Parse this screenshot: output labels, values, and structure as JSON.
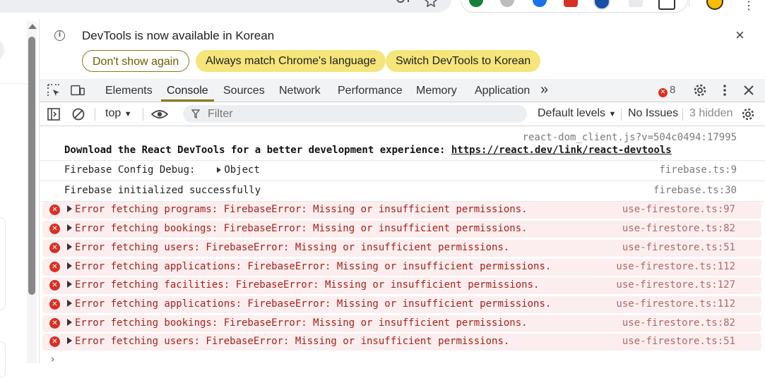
{
  "browser": {
    "extension_colors": [
      "#188038",
      "#9e9e9e",
      "#1a73e8",
      "#d93025",
      "#174ea6"
    ]
  },
  "infobar": {
    "message": "DevTools is now available in Korean",
    "dont_show_again": "Don't show again",
    "always_match": "Always match Chrome's language",
    "switch_korean": "Switch DevTools to Korean",
    "close_icon": "close-icon"
  },
  "tabs": [
    "Elements",
    "Console",
    "Sources",
    "Network",
    "Performance",
    "Memory",
    "Application"
  ],
  "active_tab": "Console",
  "toolbar": {
    "more_tabs": "»",
    "error_count": "8"
  },
  "console_bar": {
    "context": "top",
    "filter_placeholder": "Filter",
    "levels": "Default levels",
    "issues": "No Issues",
    "hidden": "3 hidden"
  },
  "logs": [
    {
      "type": "info",
      "source": "react-dom_client.js?v=504c0494:17995",
      "text": "Download the React DevTools for a better development experience: ",
      "link": "https://react.dev/link/react-devtools"
    },
    {
      "type": "info",
      "text": "Firebase Config Debug: ",
      "object": "Object",
      "source": "firebase.ts:9"
    },
    {
      "type": "info",
      "text": "Firebase initialized successfully",
      "source": "firebase.ts:30"
    },
    {
      "type": "error",
      "text": "Error fetching programs: FirebaseError: Missing or insufficient permissions.",
      "source": "use-firestore.ts:97"
    },
    {
      "type": "error",
      "text": "Error fetching bookings: FirebaseError: Missing or insufficient permissions.",
      "source": "use-firestore.ts:82"
    },
    {
      "type": "error",
      "text": "Error fetching users: FirebaseError: Missing or insufficient permissions.",
      "source": "use-firestore.ts:51"
    },
    {
      "type": "error",
      "text": "Error fetching applications: FirebaseError: Missing or insufficient permissions.",
      "source": "use-firestore.ts:112"
    },
    {
      "type": "error",
      "text": "Error fetching facilities: FirebaseError: Missing or insufficient permissions.",
      "source": "use-firestore.ts:127"
    },
    {
      "type": "error",
      "text": "Error fetching applications: FirebaseError: Missing or insufficient permissions.",
      "source": "use-firestore.ts:112"
    },
    {
      "type": "error",
      "text": "Error fetching bookings: FirebaseError: Missing or insufficient permissions.",
      "source": "use-firestore.ts:82"
    },
    {
      "type": "error",
      "text": "Error fetching users: FirebaseError: Missing or insufficient permissions.",
      "source": "use-firestore.ts:51"
    }
  ],
  "prompt": "›"
}
